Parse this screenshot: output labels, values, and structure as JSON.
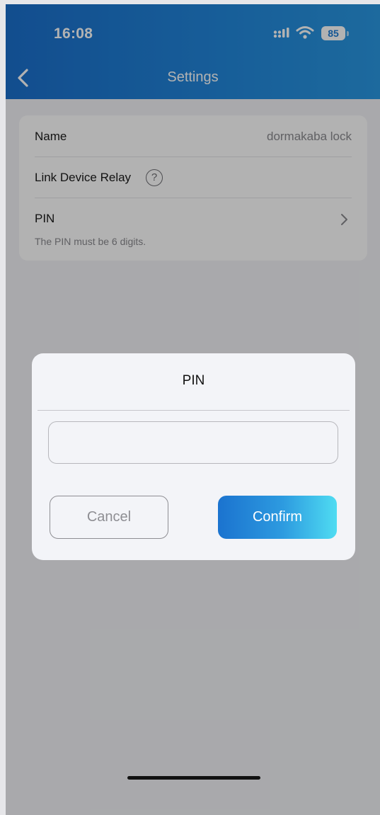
{
  "status_bar": {
    "time": "16:08",
    "battery": "85",
    "icons": [
      "signal-icon",
      "wifi-icon",
      "battery-icon"
    ]
  },
  "header": {
    "title": "Settings",
    "back_icon": "chevron-left-icon",
    "gradient_colors": [
      "#1b6fcc",
      "#2a98e2"
    ]
  },
  "settings": {
    "name_label": "Name",
    "name_value": "dormakaba lock",
    "link_relay_label": "Link Device Relay",
    "help_icon_glyph": "?",
    "pin_label": "PIN",
    "pin_hint": "The PIN must be 6 digits."
  },
  "dialog": {
    "title": "PIN",
    "input_value": "",
    "input_placeholder": "",
    "cancel_label": "Cancel",
    "confirm_label": "Confirm",
    "confirm_gradient": [
      "#1b73cf",
      "#4fdcf2"
    ]
  }
}
